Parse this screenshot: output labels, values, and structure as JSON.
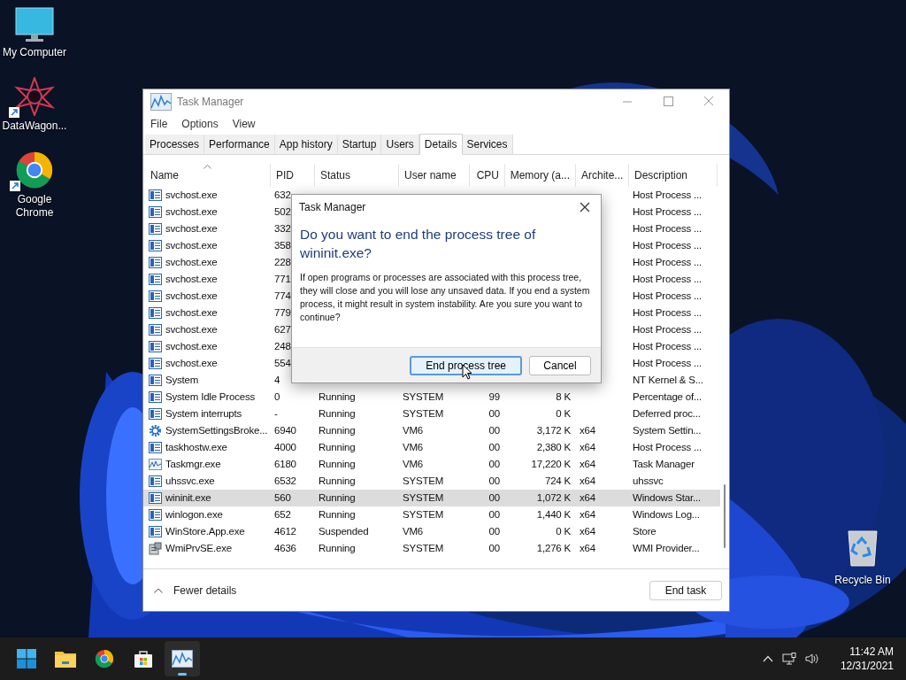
{
  "desktop_icons": [
    {
      "label": "My Computer",
      "kind": "computer"
    },
    {
      "label": "DataWagon...",
      "kind": "star"
    },
    {
      "label": "Google Chrome",
      "kind": "chrome"
    }
  ],
  "recycle_bin": {
    "label": "Recycle Bin"
  },
  "window": {
    "title": "Task Manager",
    "menu": [
      "File",
      "Options",
      "View"
    ],
    "tabs": [
      {
        "label": "Processes",
        "selected": false
      },
      {
        "label": "Performance",
        "selected": false
      },
      {
        "label": "App history",
        "selected": false
      },
      {
        "label": "Startup",
        "selected": false
      },
      {
        "label": "Users",
        "selected": false
      },
      {
        "label": "Details",
        "selected": true
      },
      {
        "label": "Services",
        "selected": false
      }
    ],
    "table": {
      "columns": [
        "Name",
        "PID",
        "Status",
        "User name",
        "CPU",
        "Memory (a...",
        "Archite...",
        "Description"
      ],
      "rows": [
        {
          "kind": "service",
          "selected": false,
          "name": "svchost.exe",
          "pid": "632",
          "description": "Host Process ..."
        },
        {
          "kind": "service",
          "selected": false,
          "name": "svchost.exe",
          "pid": "502",
          "description": "Host Process ..."
        },
        {
          "kind": "service",
          "selected": false,
          "name": "svchost.exe",
          "pid": "332",
          "description": "Host Process ..."
        },
        {
          "kind": "service",
          "selected": false,
          "name": "svchost.exe",
          "pid": "358",
          "description": "Host Process ..."
        },
        {
          "kind": "service",
          "selected": false,
          "name": "svchost.exe",
          "pid": "228",
          "description": "Host Process ..."
        },
        {
          "kind": "service",
          "selected": false,
          "name": "svchost.exe",
          "pid": "771",
          "description": "Host Process ..."
        },
        {
          "kind": "service",
          "selected": false,
          "name": "svchost.exe",
          "pid": "774",
          "description": "Host Process ..."
        },
        {
          "kind": "service",
          "selected": false,
          "name": "svchost.exe",
          "pid": "779",
          "description": "Host Process ..."
        },
        {
          "kind": "service",
          "selected": false,
          "name": "svchost.exe",
          "pid": "627",
          "description": "Host Process ..."
        },
        {
          "kind": "service",
          "selected": false,
          "name": "svchost.exe",
          "pid": "248",
          "description": "Host Process ..."
        },
        {
          "kind": "service",
          "selected": false,
          "name": "svchost.exe",
          "pid": "554",
          "description": "Host Process ..."
        },
        {
          "kind": "service",
          "selected": false,
          "name": "System",
          "pid": "4",
          "description": "NT Kernel & S..."
        },
        {
          "kind": "service",
          "selected": false,
          "name": "System Idle Process",
          "pid": "0",
          "status": "Running",
          "user": "SYSTEM",
          "cpu": "99",
          "memory": "8 K",
          "description": "Percentage of..."
        },
        {
          "kind": "service",
          "selected": false,
          "name": "System interrupts",
          "pid": "-",
          "status": "Running",
          "user": "SYSTEM",
          "cpu": "00",
          "memory": "0 K",
          "description": "Deferred proc..."
        },
        {
          "kind": "gear",
          "selected": false,
          "name": "SystemSettingsBroke...",
          "pid": "6940",
          "status": "Running",
          "user": "VM6",
          "cpu": "00",
          "memory": "3,172 K",
          "arch": "x64",
          "description": "System Settin..."
        },
        {
          "kind": "service",
          "selected": false,
          "name": "taskhostw.exe",
          "pid": "4000",
          "status": "Running",
          "user": "VM6",
          "cpu": "00",
          "memory": "2,380 K",
          "arch": "x64",
          "description": "Host Process ..."
        },
        {
          "kind": "monitor",
          "selected": false,
          "name": "Taskmgr.exe",
          "pid": "6180",
          "status": "Running",
          "user": "VM6",
          "cpu": "00",
          "memory": "17,220 K",
          "arch": "x64",
          "description": "Task Manager"
        },
        {
          "kind": "service",
          "selected": false,
          "name": "uhssvc.exe",
          "pid": "6532",
          "status": "Running",
          "user": "SYSTEM",
          "cpu": "00",
          "memory": "724 K",
          "arch": "x64",
          "description": "uhssvc"
        },
        {
          "kind": "service",
          "selected": true,
          "name": "wininit.exe",
          "pid": "560",
          "status": "Running",
          "user": "SYSTEM",
          "cpu": "00",
          "memory": "1,072 K",
          "arch": "x64",
          "description": "Windows Star..."
        },
        {
          "kind": "service",
          "selected": false,
          "name": "winlogon.exe",
          "pid": "652",
          "status": "Running",
          "user": "SYSTEM",
          "cpu": "00",
          "memory": "1,440 K",
          "arch": "x64",
          "description": "Windows Log..."
        },
        {
          "kind": "service",
          "selected": false,
          "name": "WinStore.App.exe",
          "pid": "4612",
          "status": "Suspended",
          "user": "VM6",
          "cpu": "00",
          "memory": "0 K",
          "arch": "x64",
          "description": "Store"
        },
        {
          "kind": "wmi",
          "selected": false,
          "name": "WmiPrvSE.exe",
          "pid": "4636",
          "status": "Running",
          "user": "SYSTEM",
          "cpu": "00",
          "memory": "1,276 K",
          "arch": "x64",
          "description": "WMI Provider..."
        }
      ]
    },
    "footer": {
      "toggle": "Fewer details",
      "button": "End task"
    }
  },
  "dialog": {
    "title": "Task Manager",
    "heading": "Do you want to end the process tree of wininit.exe?",
    "message": "If open programs or processes are associated with this process tree, they will close and you will lose any unsaved data. If you end a system process, it might result in system instability. Are you sure you want to continue?",
    "buttons": [
      {
        "label": "End process tree",
        "selected": true
      },
      {
        "label": "Cancel",
        "selected": false
      }
    ]
  },
  "taskbar": {
    "apps": [
      {
        "kind": "start",
        "selected": false
      },
      {
        "kind": "folder",
        "selected": false
      },
      {
        "kind": "chrome",
        "selected": false
      },
      {
        "kind": "store",
        "selected": false
      },
      {
        "kind": "monitor",
        "selected": true
      }
    ],
    "time": "11:42 AM",
    "date": "12/31/2021"
  }
}
